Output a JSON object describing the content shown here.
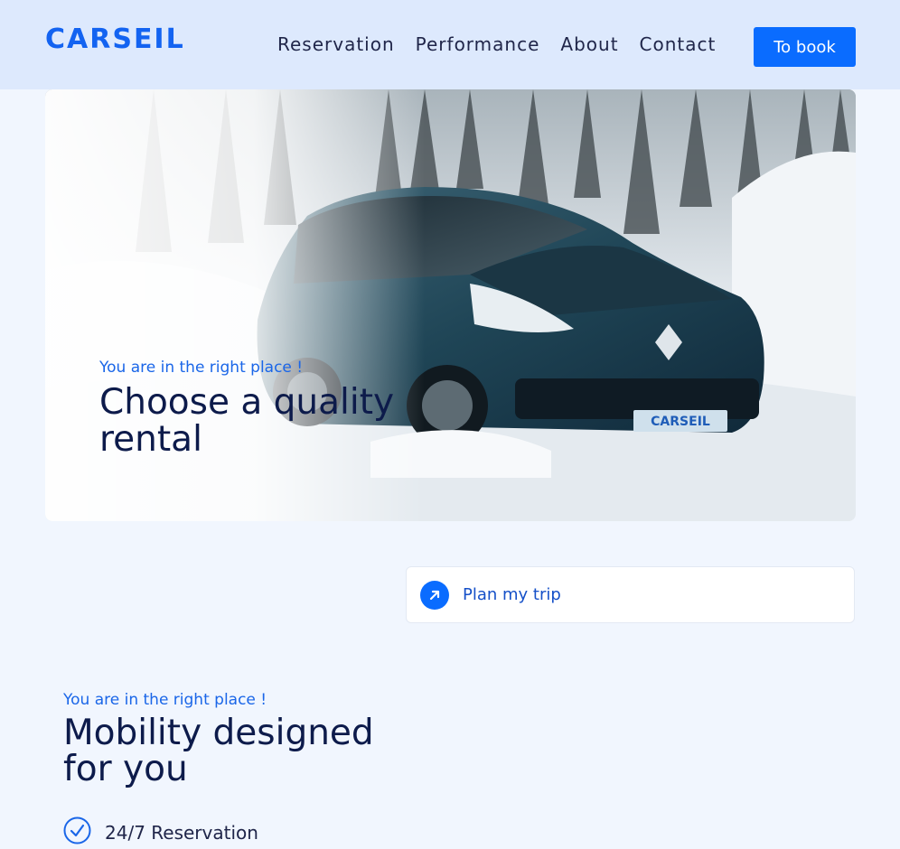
{
  "brand": {
    "name": "CARSEIL",
    "accent": "#0a6cff"
  },
  "nav": {
    "items": [
      "Reservation",
      "Performance",
      "About",
      "Contact"
    ],
    "cta": "To book"
  },
  "hero": {
    "kicker": "You are in the right place !",
    "title": "Choose a quality rental",
    "plate": "CARSEIL"
  },
  "plan": {
    "label": "Plan my trip",
    "icon": "arrow-up-right-icon"
  },
  "section": {
    "kicker": "You are in the right place !",
    "title": "Mobility designed for you",
    "features": [
      {
        "label": "24/7 Reservation",
        "icon": "check-circle-icon"
      }
    ]
  }
}
